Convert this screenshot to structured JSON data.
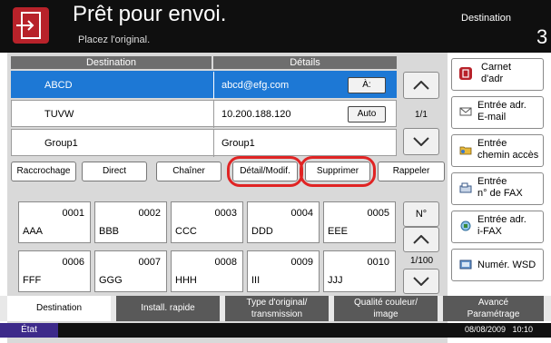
{
  "header": {
    "title": "Prêt pour envoi.",
    "subtitle": "Placez l'original.",
    "destination_label": "Destination",
    "destination_count": "3",
    "home_icon": "send-document-icon"
  },
  "table": {
    "headers": {
      "destination": "Destination",
      "details": "Détails"
    },
    "rows": [
      {
        "name": "ABCD",
        "detail": "abcd@efg.com",
        "button": "À:"
      },
      {
        "name": "TUVW",
        "detail": "10.200.188.120",
        "button": "Auto"
      },
      {
        "name": "Group1",
        "detail": "Group1",
        "button": ""
      }
    ],
    "page": "1/1"
  },
  "actions": {
    "raccrochage": "Raccrochage",
    "direct": "Direct",
    "chainer": "Chaîner",
    "detail": "Détail/Modif.",
    "supprimer": "Supprimer",
    "rappeler": "Rappeler"
  },
  "keys": [
    {
      "num": "0001",
      "name": "AAA"
    },
    {
      "num": "0002",
      "name": "BBB"
    },
    {
      "num": "0003",
      "name": "CCC"
    },
    {
      "num": "0004",
      "name": "DDD"
    },
    {
      "num": "0005",
      "name": "EEE"
    },
    {
      "num": "0006",
      "name": "FFF"
    },
    {
      "num": "0007",
      "name": "GGG"
    },
    {
      "num": "0008",
      "name": "HHH"
    },
    {
      "num": "0009",
      "name": "III"
    },
    {
      "num": "0010",
      "name": "JJJ"
    }
  ],
  "keys_nav": {
    "no": "N°",
    "page": "1/100"
  },
  "side": {
    "carnet": "Carnet\nd'adr",
    "email": "Entrée adr.\nE-mail",
    "chemin": "Entrée\nchemin accès",
    "fax": "Entrée\nn° de FAX",
    "ifax": "Entrée adr.\ni-FAX",
    "wsd": "Numér. WSD"
  },
  "tabs": {
    "destination": "Destination",
    "install": "Install. rapide",
    "type": "Type d'original/\ntransmission",
    "qualite": "Qualité couleur/\nimage",
    "avance": "Avancé\nParamétrage"
  },
  "status": {
    "etat": "État",
    "datetime": "08/08/2009   10:10"
  },
  "colors": {
    "accent": "#1d78d5",
    "brand": "#b8222a",
    "highlight": "#e02424"
  }
}
